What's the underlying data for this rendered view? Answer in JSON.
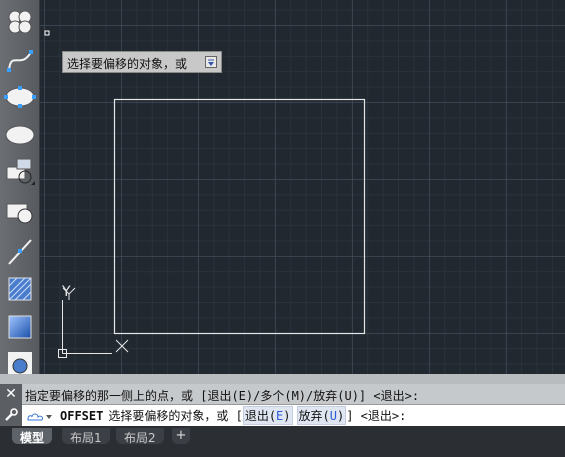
{
  "tooltip": {
    "text": "选择要偏移的对象，或"
  },
  "ucs": {
    "x_label": "X",
    "y_label": "Y"
  },
  "command": {
    "history": "指定要偏移的那一侧上的点，或 [退出(E)/多个(M)/放弃(U)] <退出>:",
    "name": "OFFSET",
    "prompt": "选择要偏移的对象，或 [",
    "opt1_label": "退出(",
    "opt1_key": "E",
    "opt1_end": ")",
    "opt2_label": "放弃(",
    "opt2_key": "U",
    "opt2_end": ")",
    "suffix": "] <退出>:"
  },
  "tabs": {
    "model": "模型",
    "layout1": "布局1",
    "layout2": "布局2",
    "add": "+"
  },
  "toolbar": {
    "icons": [
      "revision-cloud-icon",
      "spline-icon",
      "ellipse-icon",
      "ellipse-arc-icon",
      "insert-block-icon",
      "make-block-icon",
      "point-icon",
      "hatch-icon",
      "gradient-icon",
      "region-icon"
    ]
  },
  "colors": {
    "canvas": "#212830",
    "grid": "#465060",
    "geometry": "#e6e6e6"
  }
}
